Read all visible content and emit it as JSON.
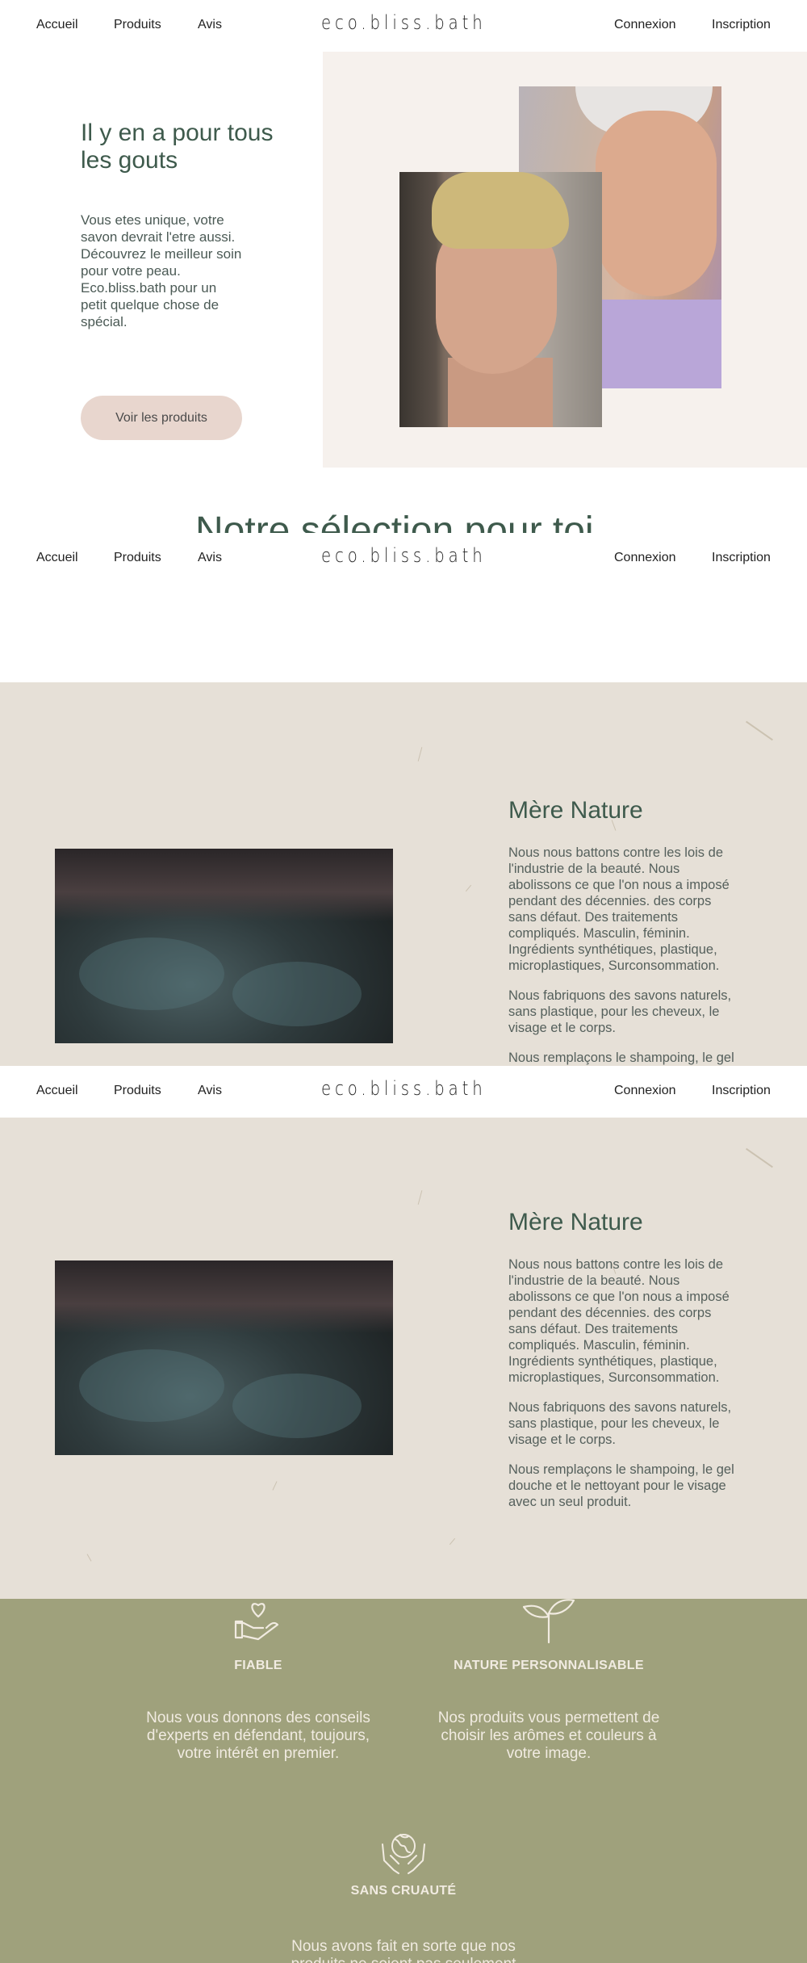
{
  "nav": {
    "accueil": "Accueil",
    "produits": "Produits",
    "avis": "Avis",
    "logo": "eco.bliss.bath",
    "connexion": "Connexion",
    "inscription": "Inscription"
  },
  "hero": {
    "title": "Il y en a pour tous les gouts",
    "text": "Vous etes unique, votre savon devrait l'etre aussi. Découvrez le meilleur soin pour votre peau. Eco.bliss.bath pour un petit quelque chose de spécial.",
    "button": "Voir les produits"
  },
  "selection": {
    "title": "Notre sélection pour toi"
  },
  "nature": {
    "title": "Mère Nature",
    "p1": "Nous nous battons contre les lois de l'industrie de la beauté. Nous abolissons ce que l'on nous a imposé pendant des décennies. des corps sans défaut. Des traitements compliqués. Masculin, féminin. Ingrédients synthétiques, plastique, microplastiques, Surconsommation.",
    "p2": "Nous fabriquons des savons naturels, sans plastique, pour les cheveux, le visage et le corps.",
    "p3": "Nous remplaçons le shampoing, le gel douche et le nettoyant pour le visage avec un seul produit."
  },
  "values": {
    "fiable_title": "FIABLE",
    "fiable_text": "Nous vous donnons des conseils d'experts en défendant, toujours, votre intérêt en premier.",
    "nature_title": "NATURE PERSONNALISABLE",
    "nature_text": "Nos produits vous permettent de choisir les arômes et couleurs à votre image.",
    "cruaute_title": "SANS CRUAUTÉ",
    "cruaute_text": "Nous avons fait en sorte que nos produits ne soient pas seulement"
  },
  "colors": {
    "accent_green": "#3e5a4c",
    "button_pink": "#e8d6ce",
    "beige_panel": "#f6f1ed",
    "nature_bg": "#e6e0d7",
    "values_bg": "#9fa17c"
  },
  "icons": [
    "hand-heart-icon",
    "sprout-icon",
    "hands-earth-icon"
  ]
}
